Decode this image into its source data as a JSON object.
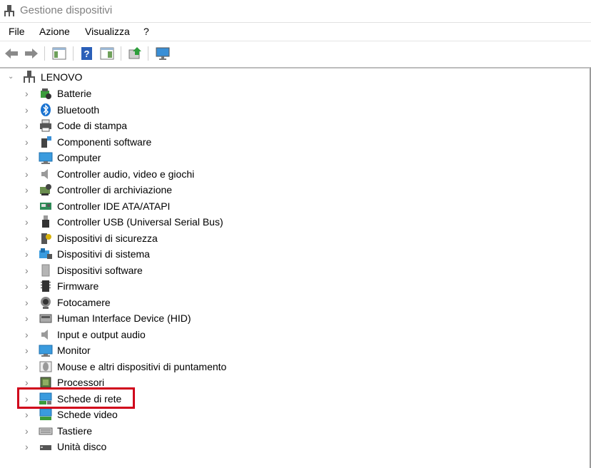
{
  "window": {
    "title": "Gestione dispositivi"
  },
  "menu": [
    "File",
    "Azione",
    "Visualizza",
    "?"
  ],
  "tree": {
    "root": "LENOVO",
    "items": [
      {
        "label": "Batterie",
        "icon": "battery-icon"
      },
      {
        "label": "Bluetooth",
        "icon": "bluetooth-icon"
      },
      {
        "label": "Code di stampa",
        "icon": "printer-icon"
      },
      {
        "label": "Componenti software",
        "icon": "software-component-icon"
      },
      {
        "label": "Computer",
        "icon": "computer-icon"
      },
      {
        "label": "Controller audio, video e giochi",
        "icon": "speaker-icon"
      },
      {
        "label": "Controller di archiviazione",
        "icon": "storage-controller-icon"
      },
      {
        "label": "Controller IDE ATA/ATAPI",
        "icon": "ide-controller-icon"
      },
      {
        "label": "Controller USB (Universal Serial Bus)",
        "icon": "usb-icon"
      },
      {
        "label": "Dispositivi di sicurezza",
        "icon": "security-device-icon"
      },
      {
        "label": "Dispositivi di sistema",
        "icon": "system-device-icon"
      },
      {
        "label": "Dispositivi software",
        "icon": "software-device-icon"
      },
      {
        "label": "Firmware",
        "icon": "firmware-icon"
      },
      {
        "label": "Fotocamere",
        "icon": "camera-icon"
      },
      {
        "label": "Human Interface Device (HID)",
        "icon": "hid-icon"
      },
      {
        "label": "Input e output audio",
        "icon": "audio-io-icon"
      },
      {
        "label": "Monitor",
        "icon": "monitor-icon"
      },
      {
        "label": "Mouse e altri dispositivi di puntamento",
        "icon": "mouse-icon"
      },
      {
        "label": "Processori",
        "icon": "processor-icon"
      },
      {
        "label": "Schede di rete",
        "icon": "network-adapter-icon",
        "highlighted": true
      },
      {
        "label": "Schede video",
        "icon": "display-adapter-icon"
      },
      {
        "label": "Tastiere",
        "icon": "keyboard-icon"
      },
      {
        "label": "Unità disco",
        "icon": "disk-drive-icon"
      }
    ]
  },
  "colors": {
    "highlight": "#d0021b",
    "title_text": "#808080"
  }
}
